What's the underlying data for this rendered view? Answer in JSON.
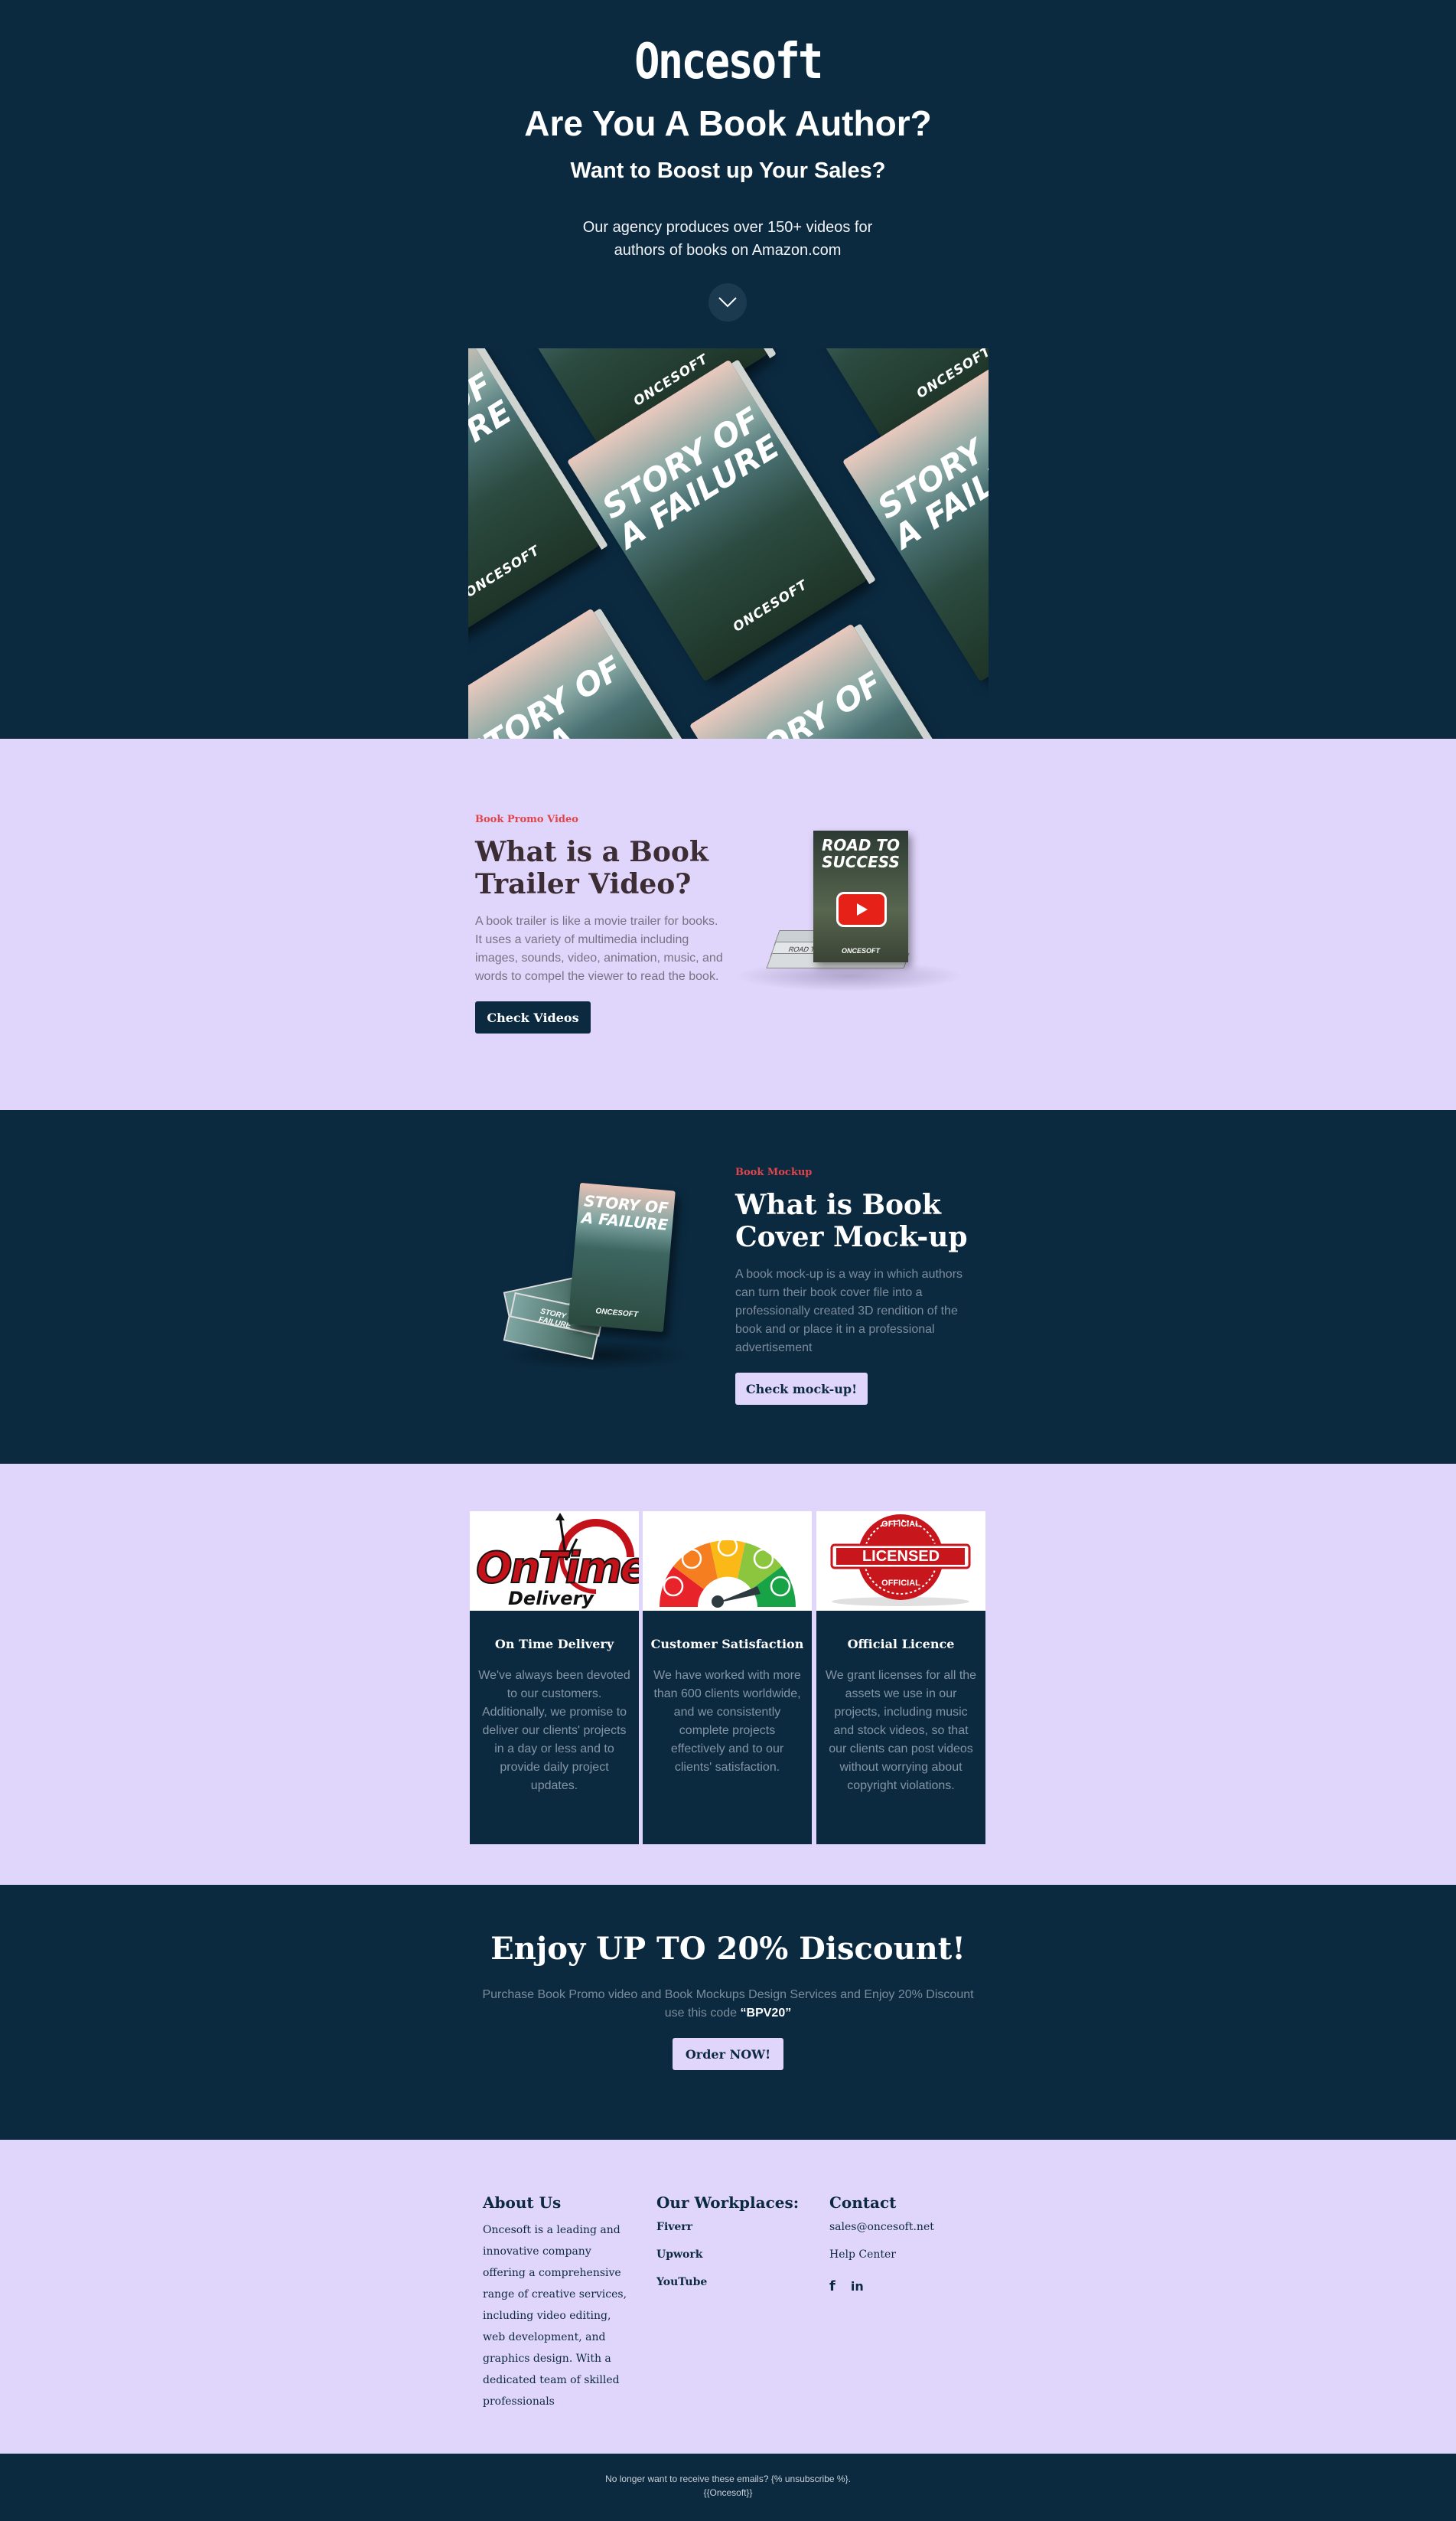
{
  "brand": {
    "logo": "Oncesoft"
  },
  "hero": {
    "title": "Are You A Book Author?",
    "subtitle": "Want to Boost up Your Sales?",
    "description": "Our agency produces over 150+ videos for authors of books on Amazon.com",
    "book_title_1": "STORY OF A FAILURE",
    "book_title_2": "STORY OF A",
    "book_publisher": "ONCESOFT"
  },
  "trailer": {
    "kicker": "Book Promo Video",
    "title": "What is a Book Trailer Video?",
    "body": "A book trailer is like a movie trailer for books. It uses a variety of multimedia including images, sounds, video, animation, music, and words to compel the viewer to read the book.",
    "button": "Check Videos",
    "book_title": "ROAD TO SUCCESS",
    "book_publisher": "ONCESOFT",
    "stack_label": "ROAD TO SUCCESS · ONCESOFT"
  },
  "mockup": {
    "kicker": "Book Mockup",
    "title": "What is Book Cover Mock-up",
    "body": "A book mock-up is a way in which authors can turn their book cover file into a professionally created 3D rendition of the book and or place it in a professional advertisement",
    "button": "Check mock-up!",
    "book_title": "STORY OF A FAILURE",
    "book_publisher": "ONCESOFT",
    "stack_label": "STORY OF A FAILURE"
  },
  "features": [
    {
      "title": "On Time Delivery",
      "body": "We've always been devoted to our customers. Additionally, we promise to deliver our clients' projects in a day or less and to provide daily project updates.",
      "img_text": "OnTime!",
      "img_sub": "Delivery"
    },
    {
      "title": "Customer Satisfaction",
      "body": "We have worked with more than 600 clients worldwide, and we consistently complete projects effectively and to our clients' satisfaction."
    },
    {
      "title": "Official Licence",
      "body": "We grant licenses for all the assets we use in our projects, including music and stock videos, so that our clients can post videos without worrying about copyright violations.",
      "img_text": "LICENSED",
      "img_top": "OFFICIAL",
      "img_bottom": "OFFICIAL"
    }
  ],
  "promo": {
    "title": "Enjoy UP TO 20% Discount!",
    "text": "Purchase Book Promo video and Book Mockups Design Services and Enjoy 20% Discount use this code",
    "code": "“BPV20”",
    "button": "Order NOW!"
  },
  "footer": {
    "about_title": "About Us",
    "about_text": "Oncesoft is a leading and innovative company offering a comprehensive range of creative services, including video editing, web development, and graphics design. With a dedicated team of skilled professionals",
    "work_title": "Our Workplaces:",
    "workplaces": [
      "Fiverr",
      "Upwork",
      "YouTube"
    ],
    "contact_title": "Contact",
    "email": "sales@oncesoft.net",
    "help": "Help Center"
  },
  "bottom": {
    "unsubscribe": "No longer want to receive these emails? {% unsubscribe %}.",
    "company": "{{Oncesoft}}"
  },
  "colors": {
    "navy": "#0b2a40",
    "lavender": "#e0d5fb",
    "accent_red": "#e0454b"
  }
}
